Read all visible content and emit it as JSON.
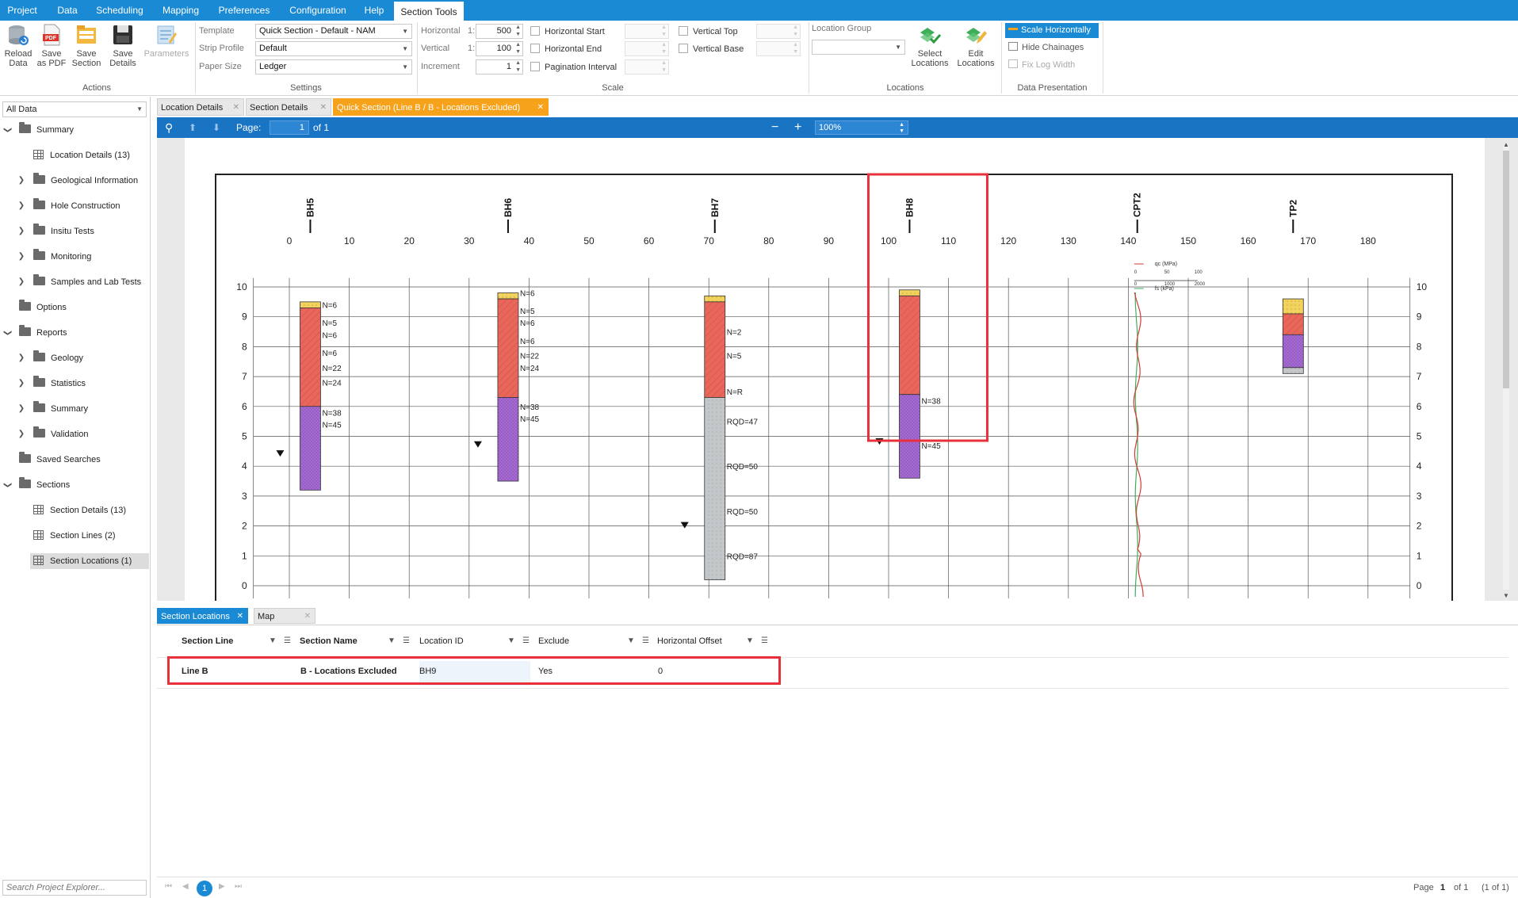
{
  "menu": [
    "Project",
    "Data",
    "Scheduling",
    "Mapping",
    "Preferences",
    "Configuration",
    "Help",
    "Section Tools"
  ],
  "ribbon": {
    "actions": {
      "reload": "Reload\nData",
      "save_pdf": "Save\nas PDF",
      "save_section": "Save\nSection",
      "save_details": "Save\nDetails",
      "parameters": "Parameters",
      "caption": "Actions"
    },
    "settings": {
      "template_label": "Template",
      "template_value": "Quick Section - Default - NAM",
      "strip_label": "Strip Profile",
      "strip_value": "Default",
      "paper_label": "Paper Size",
      "paper_value": "Ledger",
      "caption": "Settings"
    },
    "scale": {
      "horizontal_label": "Horizontal",
      "horizontal_ratio": "1:",
      "horizontal_value": "500",
      "vertical_label": "Vertical",
      "vertical_ratio": "1:",
      "vertical_value": "100",
      "increment_label": "Increment",
      "increment_value": "1",
      "h_start": "Horizontal Start",
      "h_end": "Horizontal End",
      "pagination": "Pagination Interval",
      "v_top": "Vertical Top",
      "v_base": "Vertical Base",
      "caption": "Scale"
    },
    "locations": {
      "group_label": "Location Group",
      "select": "Select\nLocations",
      "edit": "Edit\nLocations",
      "caption": "Locations"
    },
    "presentation": {
      "scale_h": "Scale Horizontally",
      "hide_chainages": "Hide Chainages",
      "fix_log": "Fix Log Width",
      "caption": "Data Presentation"
    }
  },
  "explorer": {
    "filter": "All Data",
    "search_placeholder": "Search Project Explorer...",
    "items": [
      {
        "label": "Summary",
        "level": 0,
        "type": "folder",
        "exp": "open"
      },
      {
        "label": "Location Details (13)",
        "level": 1,
        "type": "grid",
        "exp": ""
      },
      {
        "label": "Geological Information",
        "level": 1,
        "type": "folder",
        "exp": "closed"
      },
      {
        "label": "Hole Construction",
        "level": 1,
        "type": "folder",
        "exp": "closed"
      },
      {
        "label": "Insitu Tests",
        "level": 1,
        "type": "folder",
        "exp": "closed"
      },
      {
        "label": "Monitoring",
        "level": 1,
        "type": "folder",
        "exp": "closed"
      },
      {
        "label": "Samples and Lab Tests",
        "level": 1,
        "type": "folder",
        "exp": "closed"
      },
      {
        "label": "Options",
        "level": 0,
        "type": "folder",
        "exp": ""
      },
      {
        "label": "Reports",
        "level": 0,
        "type": "folder",
        "exp": "open"
      },
      {
        "label": "Geology",
        "level": 1,
        "type": "folder",
        "exp": "closed"
      },
      {
        "label": "Statistics",
        "level": 1,
        "type": "folder",
        "exp": "closed"
      },
      {
        "label": "Summary",
        "level": 1,
        "type": "folder",
        "exp": "closed"
      },
      {
        "label": "Validation",
        "level": 1,
        "type": "folder",
        "exp": "closed"
      },
      {
        "label": "Saved Searches",
        "level": 0,
        "type": "folder",
        "exp": ""
      },
      {
        "label": "Sections",
        "level": 0,
        "type": "folder",
        "exp": "open"
      },
      {
        "label": "Section Details (13)",
        "level": 1,
        "type": "grid",
        "exp": ""
      },
      {
        "label": "Section Lines (2)",
        "level": 1,
        "type": "grid",
        "exp": ""
      },
      {
        "label": "Section Locations (1)",
        "level": 1,
        "type": "grid",
        "exp": "",
        "selected": true
      }
    ]
  },
  "doc_tabs": [
    "Location Details",
    "Section Details",
    "Quick Section (Line B / B - Locations Excluded)"
  ],
  "viewer": {
    "page_label": "Page:",
    "page": "1",
    "of": "of 1",
    "zoom": "100%"
  },
  "section": {
    "x_ticks": [
      "0",
      "10",
      "20",
      "30",
      "40",
      "50",
      "60",
      "70",
      "80",
      "90",
      "100",
      "110",
      "120",
      "130",
      "140",
      "150",
      "160",
      "170",
      "180"
    ],
    "y_ticks": [
      "10",
      "9",
      "8",
      "7",
      "6",
      "5",
      "4",
      "3",
      "2",
      "1",
      "0"
    ],
    "boreholes": [
      {
        "name": "BH5",
        "chainage": 3.5,
        "layers": [
          {
            "top": 9.5,
            "bot": 9.3,
            "c": "#f2d35e"
          },
          {
            "top": 9.3,
            "bot": 6.0,
            "c": "#e8675a"
          },
          {
            "top": 6.0,
            "bot": 3.2,
            "c": "#a66bd3"
          }
        ],
        "water": 4.4,
        "labels": [
          {
            "t": "N=6",
            "y": 9.4
          },
          {
            "t": "N=5",
            "y": 8.8
          },
          {
            "t": "N=6",
            "y": 8.4
          },
          {
            "t": "N=6",
            "y": 7.8
          },
          {
            "t": "N=22",
            "y": 7.3
          },
          {
            "t": "N=24",
            "y": 6.8
          },
          {
            "t": "N=38",
            "y": 5.8
          },
          {
            "t": "N=45",
            "y": 5.4
          }
        ]
      },
      {
        "name": "BH6",
        "chainage": 36.5,
        "layers": [
          {
            "top": 9.8,
            "bot": 9.6,
            "c": "#f2d35e"
          },
          {
            "top": 9.6,
            "bot": 6.3,
            "c": "#e8675a"
          },
          {
            "top": 6.3,
            "bot": 3.5,
            "c": "#a66bd3"
          }
        ],
        "water": 4.7,
        "labels": [
          {
            "t": "N=6",
            "y": 9.8
          },
          {
            "t": "N=5",
            "y": 9.2
          },
          {
            "t": "N=6",
            "y": 8.8
          },
          {
            "t": "N=6",
            "y": 8.2
          },
          {
            "t": "N=22",
            "y": 7.7
          },
          {
            "t": "N=24",
            "y": 7.3
          },
          {
            "t": "N=38",
            "y": 6.0
          },
          {
            "t": "N=45",
            "y": 5.6
          }
        ]
      },
      {
        "name": "BH7",
        "chainage": 71.0,
        "layers": [
          {
            "top": 9.7,
            "bot": 9.5,
            "c": "#f2d35e"
          },
          {
            "top": 9.5,
            "bot": 6.3,
            "c": "#e8675a"
          },
          {
            "top": 6.3,
            "bot": 0.2,
            "c": "#c4c7c9"
          }
        ],
        "water": 2.0,
        "labels": [
          {
            "t": "N=2",
            "y": 8.5
          },
          {
            "t": "N=5",
            "y": 7.7
          },
          {
            "t": "N=R",
            "y": 6.5
          },
          {
            "t": "RQD=47",
            "y": 5.5
          },
          {
            "t": "RQD=50",
            "y": 4.0
          },
          {
            "t": "RQD=50",
            "y": 2.5
          },
          {
            "t": "RQD=87",
            "y": 1.0
          }
        ]
      },
      {
        "name": "BH8",
        "chainage": 103.5,
        "layers": [
          {
            "top": 9.9,
            "bot": 9.7,
            "c": "#f2d35e"
          },
          {
            "top": 9.7,
            "bot": 6.4,
            "c": "#e8675a"
          },
          {
            "top": 6.4,
            "bot": 3.6,
            "c": "#a66bd3"
          }
        ],
        "water": 4.8,
        "labels": [
          {
            "t": "N=38",
            "y": 6.2
          },
          {
            "t": "N=45",
            "y": 4.7
          }
        ]
      },
      {
        "name": "TP2",
        "chainage": 167.5,
        "layers": [
          {
            "top": 9.6,
            "bot": 9.1,
            "c": "#f2d35e"
          },
          {
            "top": 9.1,
            "bot": 8.4,
            "c": "#e8675a"
          },
          {
            "top": 8.4,
            "bot": 7.3,
            "c": "#a66bd3"
          },
          {
            "top": 7.3,
            "bot": 7.1,
            "c": "#c4c7c9"
          }
        ],
        "water": null,
        "labels": []
      }
    ],
    "cpt": {
      "name": "CPT2",
      "chainage": 141.5,
      "legend": [
        "qc (MPa)",
        "fs (kPa)"
      ],
      "scale1": [
        "0",
        "50",
        "100"
      ],
      "scale2": [
        "0",
        "1000",
        "2000"
      ]
    }
  },
  "bottom_tabs": [
    "Section Locations",
    "Map"
  ],
  "grid": {
    "columns": [
      "Section Line",
      "Section Name",
      "Location ID",
      "Exclude",
      "Horizontal Offset"
    ],
    "rows": [
      [
        "Line B",
        "B - Locations Excluded",
        "BH9",
        "Yes",
        "0"
      ]
    ]
  },
  "status": {
    "page_label": "Page",
    "page": "1",
    "of": "of 1",
    "count": "(1 of 1)",
    "pager_current": "1"
  },
  "colors": {
    "menu": "#1a8ad4",
    "viewer_bar": "#1a74c4",
    "active_tab": "#f7a21b",
    "highlight": "#e8303a"
  }
}
